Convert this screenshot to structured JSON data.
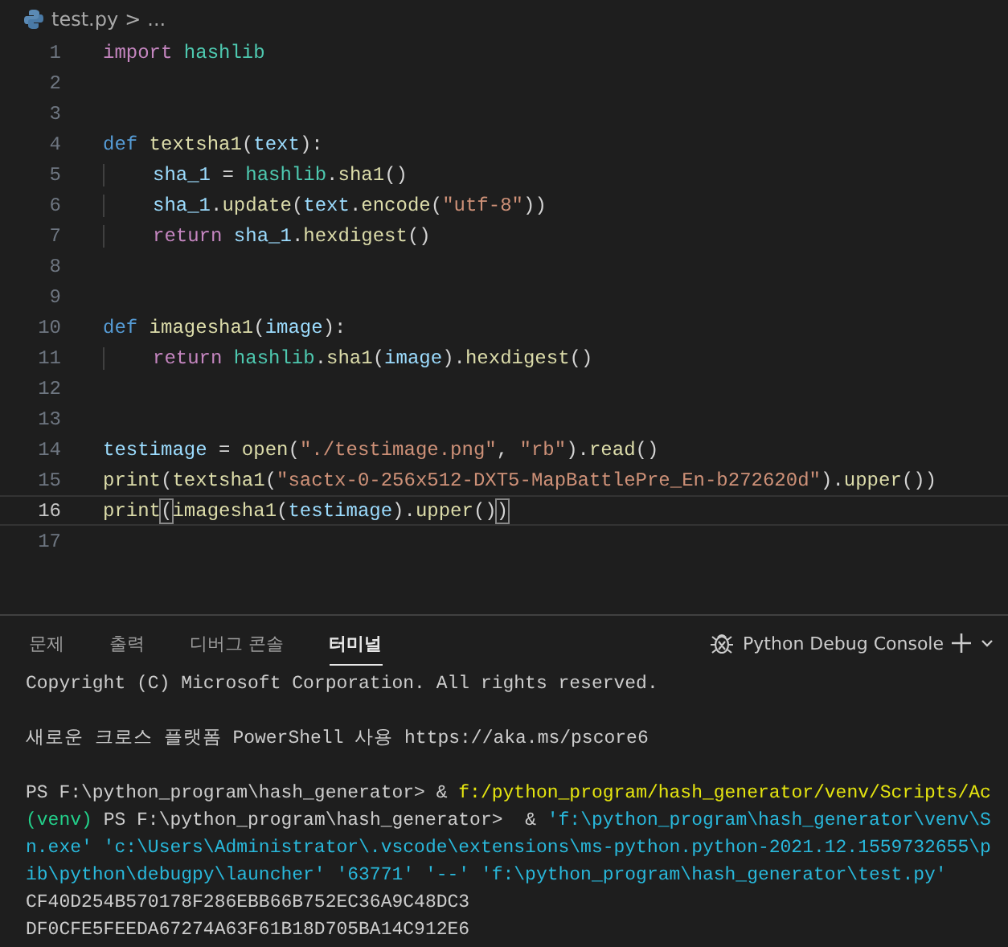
{
  "breadcrumb": {
    "file": "test.py",
    "separator": ">",
    "rest": "..."
  },
  "editor": {
    "lines": [
      {
        "number": "1",
        "current": false,
        "tokens": [
          {
            "t": "import",
            "kind": "keyword"
          },
          {
            "t": " hashlib",
            "kind": "module"
          }
        ]
      },
      {
        "number": "2",
        "current": false
      },
      {
        "number": "3",
        "current": false
      },
      {
        "number": "4",
        "current": false,
        "guide": false,
        "tokens": [
          {
            "t": "def",
            "kind": "def"
          },
          {
            "t": " textsha1",
            "kind": "function"
          },
          {
            "t": "(",
            "kind": "plain"
          },
          {
            "t": "text",
            "kind": "variable"
          },
          {
            "t": "):",
            "kind": "plain"
          }
        ]
      },
      {
        "number": "5",
        "current": false,
        "guide": true,
        "tokens": [
          {
            "t": "sha_1",
            "kind": "variable"
          },
          {
            "t": " = ",
            "kind": "plain"
          },
          {
            "t": "hashlib",
            "kind": "module"
          },
          {
            "t": ".",
            "kind": "plain"
          },
          {
            "t": "sha1",
            "kind": "function"
          },
          {
            "t": "()",
            "kind": "plain"
          }
        ]
      },
      {
        "number": "6",
        "current": false,
        "guide": true,
        "tokens": [
          {
            "t": "sha_1",
            "kind": "variable"
          },
          {
            "t": ".",
            "kind": "plain"
          },
          {
            "t": "update",
            "kind": "function"
          },
          {
            "t": "(",
            "kind": "plain"
          },
          {
            "t": "text",
            "kind": "variable"
          },
          {
            "t": ".",
            "kind": "plain"
          },
          {
            "t": "encode",
            "kind": "function"
          },
          {
            "t": "(",
            "kind": "plain"
          },
          {
            "t": "\"utf-8\"",
            "kind": "string"
          },
          {
            "t": "))",
            "kind": "plain"
          }
        ]
      },
      {
        "number": "7",
        "current": false,
        "guide": true,
        "tokens": [
          {
            "t": "return",
            "kind": "keyword"
          },
          {
            "t": " sha_1",
            "kind": "variable"
          },
          {
            "t": ".",
            "kind": "plain"
          },
          {
            "t": "hexdigest",
            "kind": "function"
          },
          {
            "t": "()",
            "kind": "plain"
          }
        ]
      },
      {
        "number": "8",
        "current": false
      },
      {
        "number": "9",
        "current": false
      },
      {
        "number": "10",
        "current": false,
        "guide": false,
        "tokens": [
          {
            "t": "def",
            "kind": "def"
          },
          {
            "t": " imagesha1",
            "kind": "function"
          },
          {
            "t": "(",
            "kind": "plain"
          },
          {
            "t": "image",
            "kind": "variable"
          },
          {
            "t": "):",
            "kind": "plain"
          }
        ]
      },
      {
        "number": "11",
        "current": false,
        "guide": true,
        "tokens": [
          {
            "t": "return",
            "kind": "keyword"
          },
          {
            "t": " hashlib",
            "kind": "module"
          },
          {
            "t": ".",
            "kind": "plain"
          },
          {
            "t": "sha1",
            "kind": "function"
          },
          {
            "t": "(",
            "kind": "plain"
          },
          {
            "t": "image",
            "kind": "variable"
          },
          {
            "t": ").",
            "kind": "plain"
          },
          {
            "t": "hexdigest",
            "kind": "function"
          },
          {
            "t": "()",
            "kind": "plain"
          }
        ]
      },
      {
        "number": "12",
        "current": false
      },
      {
        "number": "13",
        "current": false
      },
      {
        "number": "14",
        "current": false,
        "guide": false,
        "tokens": [
          {
            "t": "testimage",
            "kind": "variable"
          },
          {
            "t": " = ",
            "kind": "plain"
          },
          {
            "t": "open",
            "kind": "function"
          },
          {
            "t": "(",
            "kind": "plain"
          },
          {
            "t": "\"./testimage.png\"",
            "kind": "string"
          },
          {
            "t": ", ",
            "kind": "plain"
          },
          {
            "t": "\"rb\"",
            "kind": "string"
          },
          {
            "t": ").",
            "kind": "plain"
          },
          {
            "t": "read",
            "kind": "function"
          },
          {
            "t": "()",
            "kind": "plain"
          }
        ]
      },
      {
        "number": "15",
        "current": false,
        "guide": false,
        "tokens": [
          {
            "t": "print",
            "kind": "function"
          },
          {
            "t": "(",
            "kind": "plain"
          },
          {
            "t": "textsha1",
            "kind": "function"
          },
          {
            "t": "(",
            "kind": "plain"
          },
          {
            "t": "\"sactx-0-256x512-DXT5-MapBattlePre_En-b272620d\"",
            "kind": "string"
          },
          {
            "t": ").",
            "kind": "plain"
          },
          {
            "t": "upper",
            "kind": "function"
          },
          {
            "t": "())",
            "kind": "plain"
          }
        ]
      },
      {
        "number": "16",
        "current": true,
        "guide": false,
        "tokens": [
          {
            "t": "print",
            "kind": "function"
          },
          {
            "t": "(",
            "kind": "match"
          },
          {
            "t": "imagesha1",
            "kind": "function"
          },
          {
            "t": "(",
            "kind": "plain"
          },
          {
            "t": "testimage",
            "kind": "variable"
          },
          {
            "t": ").",
            "kind": "plain"
          },
          {
            "t": "upper",
            "kind": "function"
          },
          {
            "t": "()",
            "kind": "plain"
          },
          {
            "t": ")",
            "kind": "match"
          }
        ]
      },
      {
        "number": "17",
        "current": false
      }
    ]
  },
  "panel": {
    "tabs": [
      {
        "label": "문제",
        "selected": false
      },
      {
        "label": "출력",
        "selected": false
      },
      {
        "label": "디버그 콘솔",
        "selected": false
      },
      {
        "label": "터미널",
        "selected": true
      }
    ],
    "console_name": "Python Debug Console"
  },
  "terminal": {
    "blocks": [
      [
        [
          {
            "t": "Copyright (C) Microsoft Corporation. All rights reserved.",
            "kind": "plain"
          }
        ]
      ],
      [
        [
          {
            "t": "새로운 크로스 플랫폼 PowerShell 사용 https://aka.ms/pscore6",
            "kind": "plain"
          }
        ]
      ],
      [
        [
          {
            "t": "PS F:\\python_program\\hash_generator> & ",
            "kind": "plain"
          },
          {
            "t": "f:/python_program/hash_generator/venv/Scripts/Ac",
            "kind": "command"
          }
        ],
        [
          {
            "t": "(venv)",
            "kind": "venv"
          },
          {
            "t": " PS F:\\python_program\\hash_generator>  & ",
            "kind": "plain"
          },
          {
            "t": "'f:\\python_program\\hash_generator\\venv\\S",
            "kind": "argument"
          }
        ],
        [
          {
            "t": "n.exe' 'c:\\Users\\Administrator\\.vscode\\extensions\\ms-python.python-2021.12.1559732655\\p",
            "kind": "argument"
          }
        ],
        [
          {
            "t": "ib\\python\\debugpy\\launcher' '63771' '--' 'f:\\python_program\\hash_generator\\test.py'",
            "kind": "argument"
          }
        ],
        [
          {
            "t": "CF40D254B570178F286EBB66B752EC36A9C48DC3",
            "kind": "plain"
          }
        ],
        [
          {
            "t": "DF0CFE5FEEDA67274A63F61B18D705BA14C912E6",
            "kind": "plain"
          }
        ]
      ]
    ]
  }
}
